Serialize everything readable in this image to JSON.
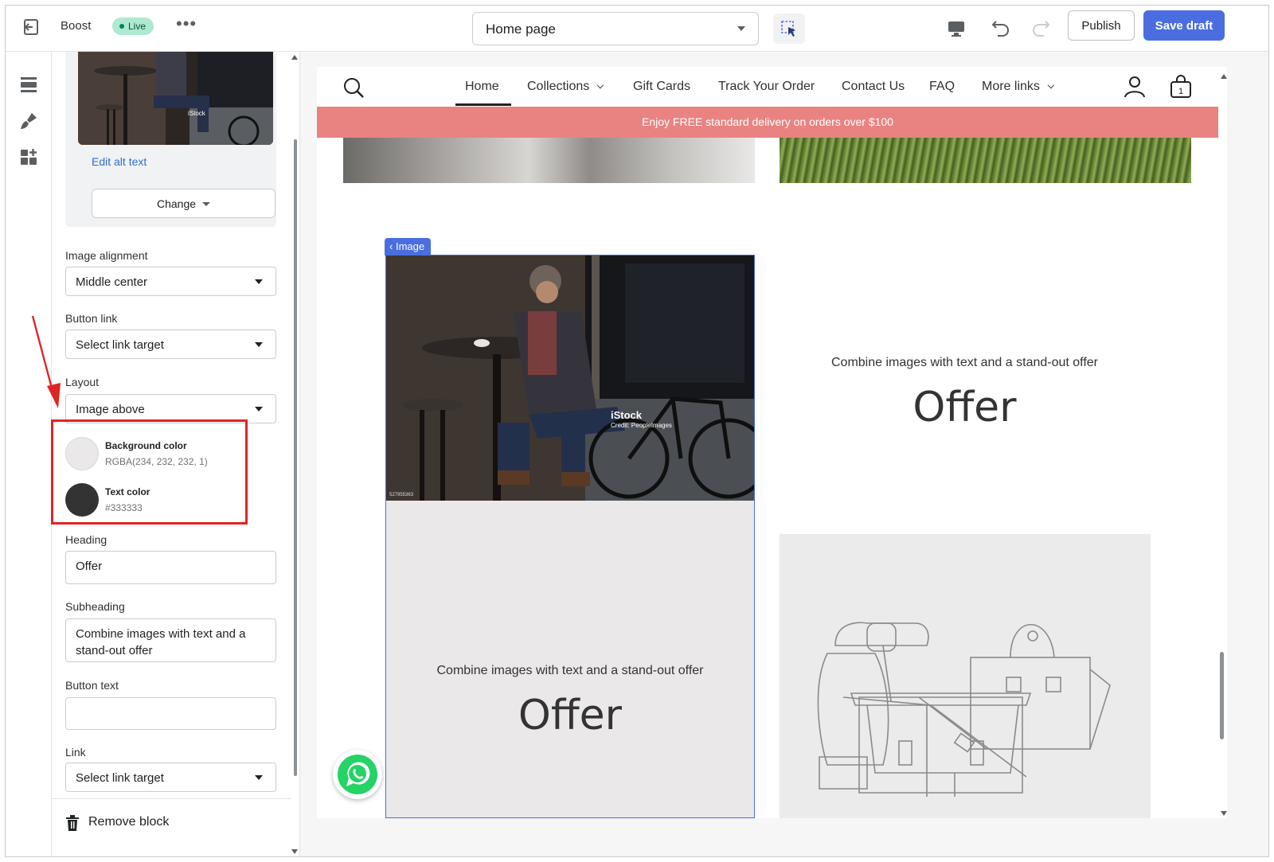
{
  "topbar": {
    "store_name": "Boost",
    "status_badge": "Live",
    "page_selector": "Home page",
    "publish_label": "Publish",
    "save_label": "Save draft"
  },
  "panel": {
    "edit_alt_text": "Edit alt text",
    "change_label": "Change",
    "image_alignment": {
      "label": "Image alignment",
      "value": "Middle center"
    },
    "button_link": {
      "label": "Button link",
      "value": "Select link target"
    },
    "layout": {
      "label": "Layout",
      "value": "Image above"
    },
    "background_color": {
      "label": "Background color",
      "value": "RGBA(234, 232, 232, 1)",
      "swatch": "#eae8e8"
    },
    "text_color": {
      "label": "Text color",
      "value": "#333333",
      "swatch": "#333333"
    },
    "heading": {
      "label": "Heading",
      "value": "Offer"
    },
    "subheading": {
      "label": "Subheading",
      "value": "Combine images with text and a stand-out offer"
    },
    "button_text": {
      "label": "Button text",
      "value": ""
    },
    "link": {
      "label": "Link",
      "value": "Select link target"
    },
    "remove_block": "Remove block"
  },
  "preview": {
    "nav": [
      "Home",
      "Collections",
      "Gift Cards",
      "Track Your Order",
      "Contact Us",
      "FAQ",
      "More links"
    ],
    "cart_count": "1",
    "banner": "Enjoy FREE standard delivery on orders over $100",
    "block_tag": "Image",
    "card_subheading": "Combine images with text and a stand-out offer",
    "card_heading": "Offer",
    "right_subheading": "Combine images with text and a stand-out offer",
    "right_heading": "Offer",
    "photo_watermark": "iStock",
    "photo_credit": "Credit: PeopleImages",
    "photo_id": "527955363"
  },
  "colors": {
    "accent": "#4a6ee0",
    "banner": "#e98381",
    "annotation": "#e02424",
    "live": "#aee9d1"
  }
}
